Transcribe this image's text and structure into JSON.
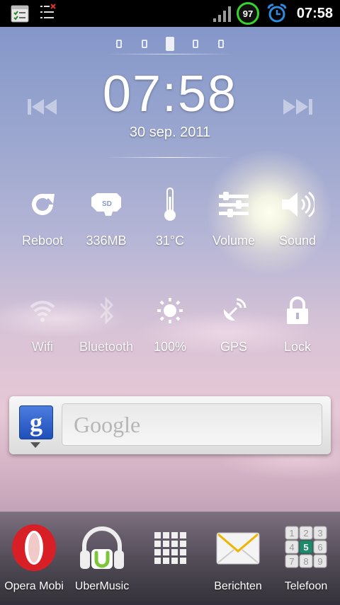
{
  "status_bar": {
    "time": "07:58",
    "battery_level": "97",
    "icons": [
      "tasks-app-icon",
      "checklist-icon",
      "signal-icon",
      "alarm-icon"
    ]
  },
  "lockscreen": {
    "time": "07:58",
    "date": "30 sep. 2011",
    "page_count": 5,
    "active_page": 3
  },
  "toggles_row1": [
    {
      "label": "Reboot",
      "icon": "reboot-icon"
    },
    {
      "label": "336MB",
      "icon": "sd-card-icon"
    },
    {
      "label": "31°C",
      "icon": "thermometer-icon"
    },
    {
      "label": "Volume",
      "icon": "volume-sliders-icon"
    },
    {
      "label": "Sound",
      "icon": "speaker-icon"
    }
  ],
  "toggles_row2": [
    {
      "label": "Wifi",
      "icon": "wifi-icon"
    },
    {
      "label": "Bluetooth",
      "icon": "bluetooth-icon"
    },
    {
      "label": "100%",
      "icon": "brightness-icon"
    },
    {
      "label": "GPS",
      "icon": "gps-satellite-icon"
    },
    {
      "label": "Lock",
      "icon": "lock-icon"
    }
  ],
  "google_widget": {
    "logo_letter": "g",
    "placeholder": "Google"
  },
  "dock": [
    {
      "label": "Opera Mobi",
      "icon": "opera-icon"
    },
    {
      "label": "UberMusic",
      "icon": "ubermusic-headphones-icon"
    },
    {
      "label": "",
      "icon": "app-drawer-grid-icon"
    },
    {
      "label": "Berichten",
      "icon": "messages-envelope-icon"
    },
    {
      "label": "Telefoon",
      "icon": "phone-dialpad-icon"
    }
  ],
  "colors": {
    "battery_ring": "#35d42b",
    "alarm_blue": "#2f8be0",
    "opera_red": "#d81f26",
    "google_blue": "#2a5bc8"
  }
}
